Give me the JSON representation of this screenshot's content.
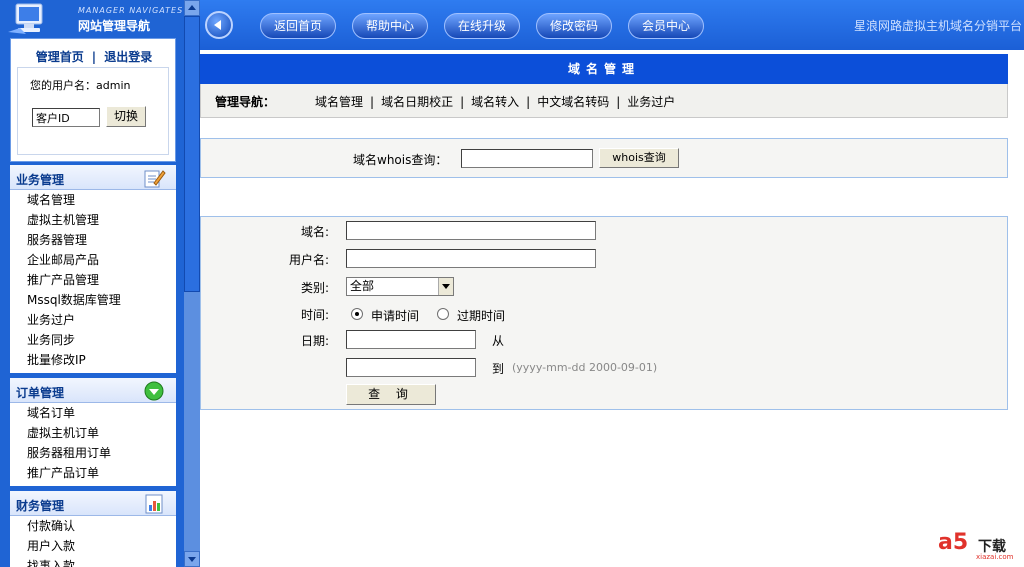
{
  "logo": {
    "eng": "MANAGER NAVIGATES",
    "title": "网站管理导航"
  },
  "userbox": {
    "home_link": "管理首页",
    "divider": "|",
    "logout_link": "退出登录",
    "username_label": "您的用户名：admin",
    "customer_id_value": "客户ID",
    "switch_label": "切换"
  },
  "sidebar": {
    "sections": [
      {
        "title": "业务管理",
        "items": [
          "域名管理",
          "虚拟主机管理",
          "服务器管理",
          "企业邮局产品",
          "推广产品管理",
          "Mssql数据库管理",
          "业务过户",
          "业务同步",
          "批量修改IP"
        ]
      },
      {
        "title": "订单管理",
        "items": [
          "域名订单",
          "虚拟主机订单",
          "服务器租用订单",
          "推广产品订单"
        ]
      },
      {
        "title": "财务管理",
        "items": [
          "付款确认",
          "用户入款",
          "找事入款"
        ]
      }
    ]
  },
  "topbar": {
    "buttons": [
      "返回首页",
      "帮助中心",
      "在线升级",
      "修改密码",
      "会员中心"
    ],
    "site_title": "星浪网路虚拟主机域名分销平台"
  },
  "main": {
    "title": "域名管理",
    "nav_label": "管理导航：",
    "nav_items": [
      "域名管理",
      "域名日期校正",
      "域名转入",
      "中文域名转码",
      "业务过户"
    ],
    "nav_sep": "|",
    "whois_label": "域名whois查询：",
    "whois_button": "whois查询",
    "form": {
      "domain_label": "域名:",
      "user_label": "用户名:",
      "type_label": "类别:",
      "type_value": "全部",
      "time_label": "时间:",
      "radio_apply": "申请时间",
      "radio_expire": "过期时间",
      "date_label": "日期:",
      "from_label": "从",
      "to_label": "到",
      "date_hint": "(yyyy-mm-dd 2000-09-01)",
      "query_button": "查 询"
    }
  },
  "watermark": {
    "logo": "a5",
    "text": "下载",
    "site": "xiazai.com"
  },
  "colors": {
    "sidebar_bg": "#1f64d4",
    "title_bar": "#0c4fd9",
    "topbar": "#1b5fd6"
  }
}
